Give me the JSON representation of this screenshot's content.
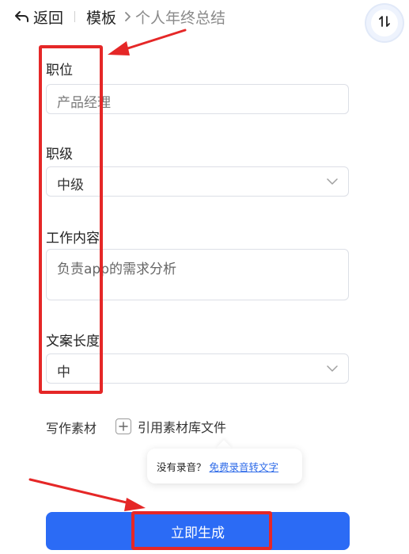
{
  "header": {
    "back_label": "返回",
    "current": "模板",
    "sub": "个人年终总结"
  },
  "form": {
    "position": {
      "label": "职位",
      "placeholder": "产品经理"
    },
    "level": {
      "label": "职级",
      "value": "中级"
    },
    "work_content": {
      "label": "工作内容",
      "value": "负责app的需求分析"
    },
    "length": {
      "label": "文案长度",
      "value": "中"
    }
  },
  "material": {
    "label": "写作素材",
    "add_label": "引用素材库文件"
  },
  "tooltip": {
    "text": "没有录音？",
    "link": "免费录音转文字"
  },
  "generate_button": "立即生成",
  "colors": {
    "primary": "#2b6bf5",
    "annotation": "#e52727",
    "link": "#2d6ae8"
  },
  "icons": {
    "back": "undo-arrow-icon",
    "chevron": "chevron-right-icon",
    "sort": "swap-vertical-icon",
    "dropdown": "chevron-down-icon",
    "add": "plus-icon"
  }
}
